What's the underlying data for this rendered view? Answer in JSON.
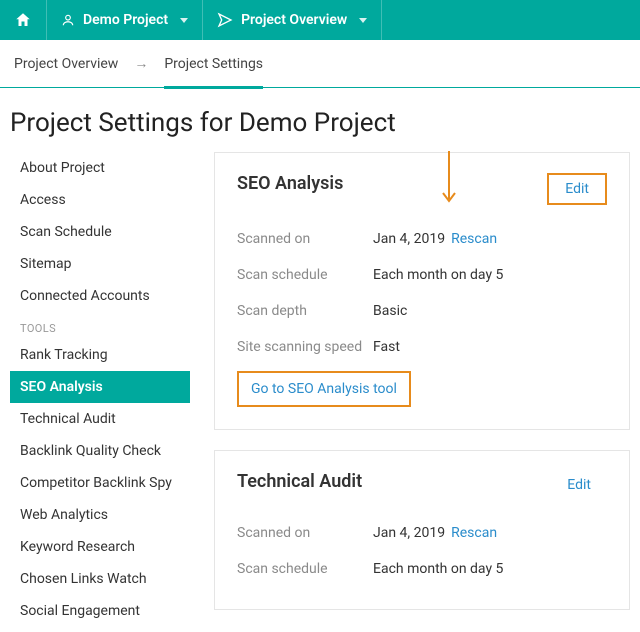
{
  "topnav": {
    "project_label": "Demo Project",
    "section_label": "Project Overview"
  },
  "breadcrumb": {
    "item0": "Project Overview",
    "sep": "→",
    "item1": "Project Settings"
  },
  "page_title": "Project Settings for Demo Project",
  "sidebar": {
    "items": [
      {
        "label": "About Project"
      },
      {
        "label": "Access"
      },
      {
        "label": "Scan Schedule"
      },
      {
        "label": "Sitemap"
      },
      {
        "label": "Connected Accounts"
      }
    ],
    "tools_heading": "TOOLS",
    "tools": [
      {
        "label": "Rank Tracking"
      },
      {
        "label": "SEO Analysis"
      },
      {
        "label": "Technical Audit"
      },
      {
        "label": "Backlink Quality Check"
      },
      {
        "label": "Competitor Backlink Spy"
      },
      {
        "label": "Web Analytics"
      },
      {
        "label": "Keyword Research"
      },
      {
        "label": "Chosen Links Watch"
      },
      {
        "label": "Social Engagement"
      }
    ]
  },
  "cards": {
    "seo": {
      "title": "SEO Analysis",
      "edit": "Edit",
      "rows": [
        {
          "label": "Scanned on",
          "value": "Jan 4, 2019",
          "action": "Rescan"
        },
        {
          "label": "Scan schedule",
          "value": "Each month on day 5"
        },
        {
          "label": "Scan depth",
          "value": "Basic"
        },
        {
          "label": "Site scanning speed",
          "value": "Fast"
        }
      ],
      "cta": "Go to SEO Analysis tool"
    },
    "tech": {
      "title": "Technical Audit",
      "edit": "Edit",
      "rows": [
        {
          "label": "Scanned on",
          "value": "Jan 4, 2019",
          "action": "Rescan"
        },
        {
          "label": "Scan schedule",
          "value": "Each month on day 5"
        }
      ]
    }
  },
  "colors": {
    "teal": "#00a99d",
    "link": "#2a8ccb",
    "highlight": "#e78b1c"
  }
}
